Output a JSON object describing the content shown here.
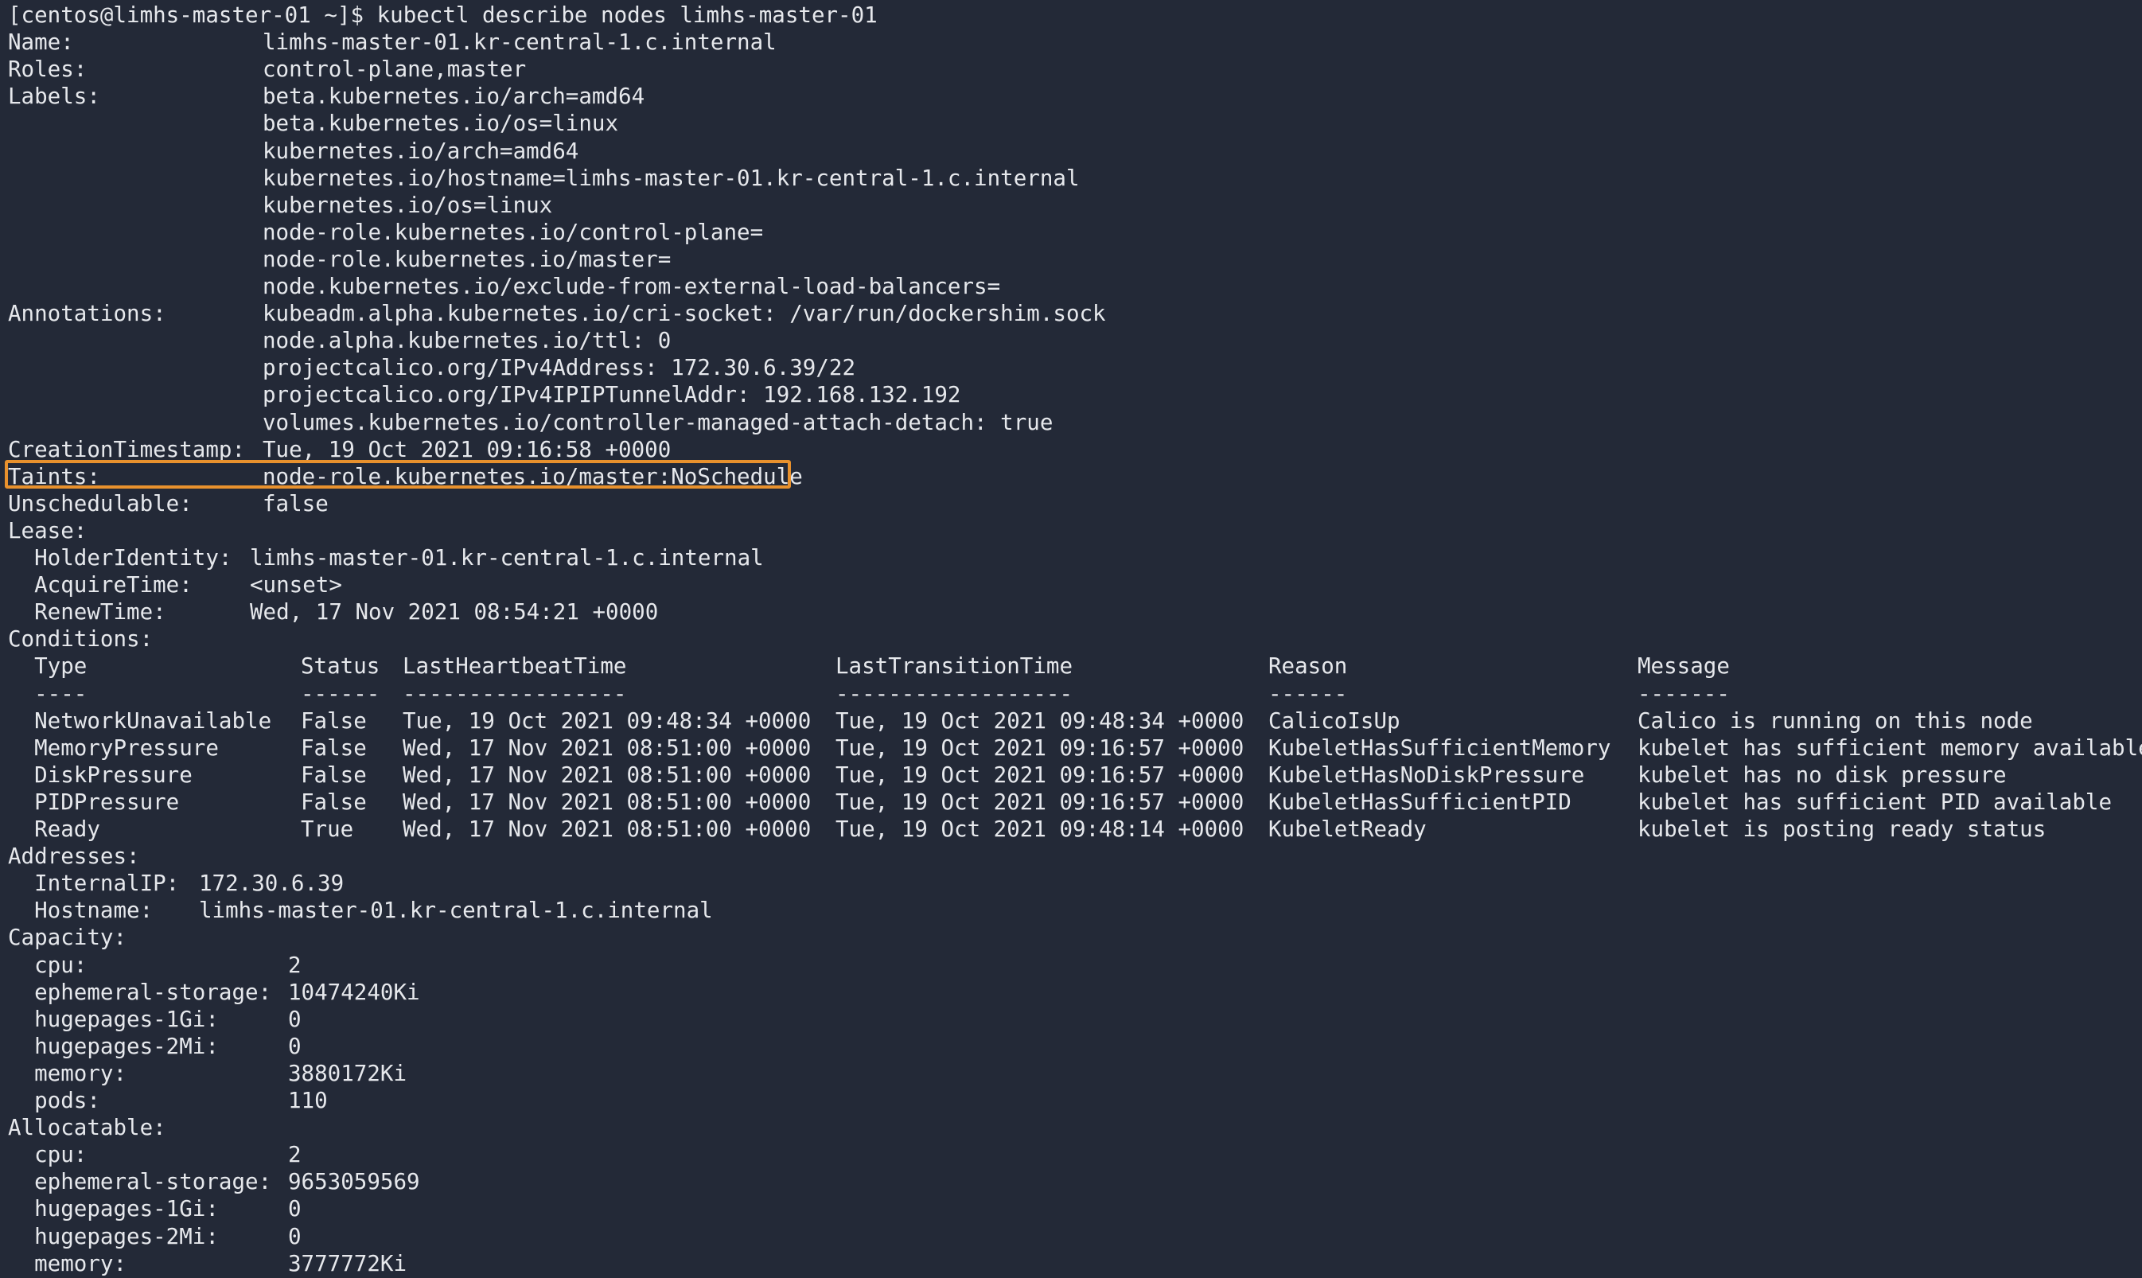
{
  "terminal": {
    "highlight_color": "#e8912d",
    "background_color": "#232937",
    "text_color": "#e6e8ec",
    "lines": [
      {
        "segments": [
          "[centos@limhs-master-01 ~]$ kubectl describe nodes limhs-master-01"
        ]
      },
      {
        "segments": [
          "Name:",
          "limhs-master-01.kr-central-1.c.internal"
        ]
      },
      {
        "segments": [
          "Roles:",
          "control-plane,master"
        ]
      },
      {
        "segments": [
          "Labels:",
          "beta.kubernetes.io/arch=amd64"
        ]
      },
      {
        "segments": [
          "",
          "beta.kubernetes.io/os=linux"
        ]
      },
      {
        "segments": [
          "",
          "kubernetes.io/arch=amd64"
        ]
      },
      {
        "segments": [
          "",
          "kubernetes.io/hostname=limhs-master-01.kr-central-1.c.internal"
        ]
      },
      {
        "segments": [
          "",
          "kubernetes.io/os=linux"
        ]
      },
      {
        "segments": [
          "",
          "node-role.kubernetes.io/control-plane="
        ]
      },
      {
        "segments": [
          "",
          "node-role.kubernetes.io/master="
        ]
      },
      {
        "segments": [
          "",
          "node.kubernetes.io/exclude-from-external-load-balancers="
        ]
      },
      {
        "segments": [
          "Annotations:",
          "kubeadm.alpha.kubernetes.io/cri-socket: /var/run/dockershim.sock"
        ]
      },
      {
        "segments": [
          "",
          "node.alpha.kubernetes.io/ttl: 0"
        ]
      },
      {
        "segments": [
          "",
          "projectcalico.org/IPv4Address: 172.30.6.39/22"
        ]
      },
      {
        "segments": [
          "",
          "projectcalico.org/IPv4IPIPTunnelAddr: 192.168.132.192"
        ]
      },
      {
        "segments": [
          "",
          "volumes.kubernetes.io/controller-managed-attach-detach: true"
        ]
      },
      {
        "segments": [
          "CreationTimestamp:",
          "Tue, 19 Oct 2021 09:16:58 +0000"
        ]
      },
      {
        "segments": [
          "Taints:",
          "node-role.kubernetes.io/master:NoSchedule"
        ]
      },
      {
        "segments": [
          "Unschedulable:",
          "false"
        ]
      },
      {
        "segments": [
          "Lease:"
        ]
      },
      {
        "segments": [
          "  HolderIdentity:",
          "limhs-master-01.kr-central-1.c.internal"
        ]
      },
      {
        "segments": [
          "  AcquireTime:",
          "<unset>"
        ]
      },
      {
        "segments": [
          "  RenewTime:",
          "Wed, 17 Nov 2021 08:54:21 +0000"
        ]
      },
      {
        "segments": [
          "Conditions:"
        ]
      },
      {
        "segments": [
          "  Type",
          "Status",
          "LastHeartbeatTime",
          "LastTransitionTime",
          "Reason",
          "Message"
        ]
      },
      {
        "segments": [
          "  ----",
          "------",
          "-----------------",
          "------------------",
          "------",
          "-------"
        ]
      },
      {
        "segments": [
          "  NetworkUnavailable",
          "False",
          "Tue, 19 Oct 2021 09:48:34 +0000",
          "Tue, 19 Oct 2021 09:48:34 +0000",
          "CalicoIsUp",
          "Calico is running on this node"
        ]
      },
      {
        "segments": [
          "  MemoryPressure",
          "False",
          "Wed, 17 Nov 2021 08:51:00 +0000",
          "Tue, 19 Oct 2021 09:16:57 +0000",
          "KubeletHasSufficientMemory",
          "kubelet has sufficient memory available"
        ]
      },
      {
        "segments": [
          "  DiskPressure",
          "False",
          "Wed, 17 Nov 2021 08:51:00 +0000",
          "Tue, 19 Oct 2021 09:16:57 +0000",
          "KubeletHasNoDiskPressure",
          "kubelet has no disk pressure"
        ]
      },
      {
        "segments": [
          "  PIDPressure",
          "False",
          "Wed, 17 Nov 2021 08:51:00 +0000",
          "Tue, 19 Oct 2021 09:16:57 +0000",
          "KubeletHasSufficientPID",
          "kubelet has sufficient PID available"
        ]
      },
      {
        "segments": [
          "  Ready",
          "True",
          "Wed, 17 Nov 2021 08:51:00 +0000",
          "Tue, 19 Oct 2021 09:48:14 +0000",
          "KubeletReady",
          "kubelet is posting ready status"
        ]
      },
      {
        "segments": [
          "Addresses:"
        ]
      },
      {
        "segments": [
          "  InternalIP:",
          "172.30.6.39"
        ]
      },
      {
        "segments": [
          "  Hostname:",
          "limhs-master-01.kr-central-1.c.internal"
        ]
      },
      {
        "segments": [
          "Capacity:"
        ]
      },
      {
        "segments": [
          "  cpu:",
          "2"
        ]
      },
      {
        "segments": [
          "  ephemeral-storage:",
          "10474240Ki"
        ]
      },
      {
        "segments": [
          "  hugepages-1Gi:",
          "0"
        ]
      },
      {
        "segments": [
          "  hugepages-2Mi:",
          "0"
        ]
      },
      {
        "segments": [
          "  memory:",
          "3880172Ki"
        ]
      },
      {
        "segments": [
          "  pods:",
          "110"
        ]
      },
      {
        "segments": [
          "Allocatable:"
        ]
      },
      {
        "segments": [
          "  cpu:",
          "2"
        ]
      },
      {
        "segments": [
          "  ephemeral-storage:",
          "9653059569"
        ]
      },
      {
        "segments": [
          "  hugepages-1Gi:",
          "0"
        ]
      },
      {
        "segments": [
          "  hugepages-2Mi:",
          "0"
        ]
      },
      {
        "segments": [
          "  memory:",
          "3777772Ki"
        ]
      }
    ]
  }
}
